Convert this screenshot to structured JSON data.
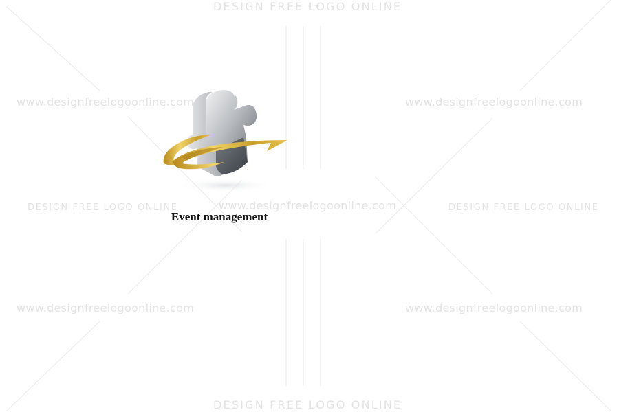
{
  "watermark": {
    "top_banner": "DESIGN FREE LOGO ONLINE",
    "bottom_banner": "DESIGN FREE LOGO ONLINE",
    "mid_left_banner": "DESIGN FREE LOGO ONLINE",
    "mid_right_banner": "DESIGN FREE LOGO ONLINE",
    "url_top_left": "www.designfreelogoonline.com",
    "url_top_right": "www.designfreelogoonline.com",
    "url_center": "www.designfreelogoonline.com",
    "url_bottom_left": "www.designfreelogoonline.com",
    "url_bottom_right": "www.designfreelogoonline.com"
  },
  "logo": {
    "icon": "puzzle-piece-with-gold-swoosh-icon",
    "caption": "Event management",
    "colors": {
      "gold": "#c9a227",
      "silver": "#9a9ea3",
      "dark": "#4a4f55"
    }
  }
}
